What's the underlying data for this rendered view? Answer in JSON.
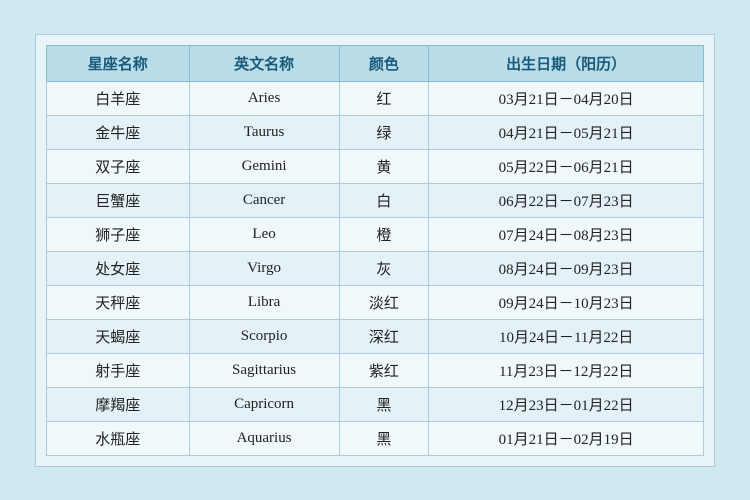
{
  "table": {
    "headers": [
      "星座名称",
      "英文名称",
      "颜色",
      "出生日期（阳历）"
    ],
    "rows": [
      {
        "zh": "白羊座",
        "en": "Aries",
        "color": "红",
        "date": "03月21日－04月20日"
      },
      {
        "zh": "金牛座",
        "en": "Taurus",
        "color": "绿",
        "date": "04月21日－05月21日"
      },
      {
        "zh": "双子座",
        "en": "Gemini",
        "color": "黄",
        "date": "05月22日－06月21日"
      },
      {
        "zh": "巨蟹座",
        "en": "Cancer",
        "color": "白",
        "date": "06月22日－07月23日"
      },
      {
        "zh": "狮子座",
        "en": "Leo",
        "color": "橙",
        "date": "07月24日－08月23日"
      },
      {
        "zh": "处女座",
        "en": "Virgo",
        "color": "灰",
        "date": "08月24日－09月23日"
      },
      {
        "zh": "天秤座",
        "en": "Libra",
        "color": "淡红",
        "date": "09月24日－10月23日"
      },
      {
        "zh": "天蝎座",
        "en": "Scorpio",
        "color": "深红",
        "date": "10月24日－11月22日"
      },
      {
        "zh": "射手座",
        "en": "Sagittarius",
        "color": "紫红",
        "date": "11月23日－12月22日"
      },
      {
        "zh": "摩羯座",
        "en": "Capricorn",
        "color": "黑",
        "date": "12月23日－01月22日"
      },
      {
        "zh": "水瓶座",
        "en": "Aquarius",
        "color": "黑",
        "date": "01月21日－02月19日"
      }
    ],
    "col0": "星座名称",
    "col1": "英文名称",
    "col2": "颜色",
    "col3": "出生日期（阳历）"
  }
}
